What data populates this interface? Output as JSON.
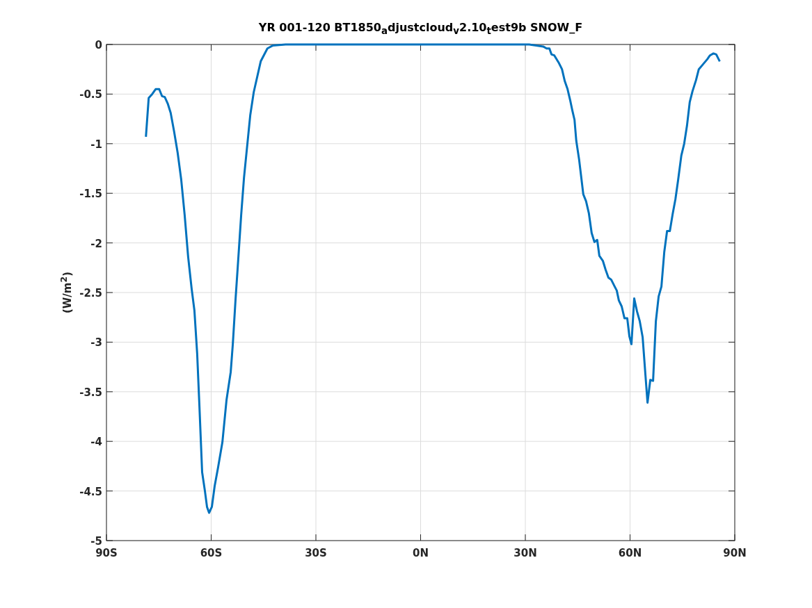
{
  "figure": {
    "chart_data": {
      "type": "line",
      "title": "YR 001-120 BT1850$_{a}$djustcloud$_{v}$2.10$_{t}$est9b SNOW_F",
      "ylabel": "(W/m$^{2}$)",
      "x": [
        -78.7,
        -77.9,
        -76.9,
        -75.9,
        -74.9,
        -74.1,
        -73.3,
        -72.4,
        -71.6,
        -70.6,
        -69.6,
        -68.6,
        -67.6,
        -66.6,
        -65.6,
        -64.8,
        -64.0,
        -63.4,
        -62.6,
        -61.8,
        -61.2,
        -60.6,
        -59.8,
        -59.0,
        -58.0,
        -56.8,
        -55.6,
        -54.4,
        -53.8,
        -53.0,
        -52.4,
        -51.4,
        -50.6,
        -49.8,
        -48.8,
        -47.8,
        -45.8,
        -43.9,
        -42.3,
        -38.7,
        31.1,
        33.1,
        35.1,
        36.1,
        36.9,
        37.5,
        38.3,
        39.5,
        40.5,
        41.3,
        42.1,
        42.9,
        43.5,
        44.1,
        44.6,
        45.4,
        46.6,
        47.4,
        48.2,
        49.0,
        49.8,
        50.6,
        51.2,
        52.2,
        53.0,
        53.8,
        54.6,
        55.6,
        56.2,
        56.8,
        57.6,
        58.4,
        59.2,
        59.8,
        60.4,
        61.2,
        62.0,
        62.8,
        63.6,
        64.4,
        65.0,
        65.8,
        66.6,
        67.4,
        68.2,
        69.0,
        69.8,
        70.6,
        71.4,
        72.2,
        73.0,
        73.8,
        74.7,
        75.5,
        76.3,
        77.1,
        77.9,
        78.9,
        79.7,
        80.9,
        82.1,
        82.9,
        83.9,
        84.7,
        85.7
      ],
      "series": [
        {
          "color": "#0072bd",
          "values": [
            -0.93,
            -0.54,
            -0.5,
            -0.45,
            -0.45,
            -0.52,
            -0.53,
            -0.6,
            -0.69,
            -0.88,
            -1.09,
            -1.36,
            -1.72,
            -2.14,
            -2.46,
            -2.68,
            -3.12,
            -3.61,
            -4.31,
            -4.5,
            -4.66,
            -4.72,
            -4.66,
            -4.45,
            -4.26,
            -4.01,
            -3.58,
            -3.3,
            -3.02,
            -2.56,
            -2.25,
            -1.72,
            -1.34,
            -1.06,
            -0.71,
            -0.48,
            -0.17,
            -0.04,
            -0.01,
            0,
            0,
            -0.01,
            -0.02,
            -0.04,
            -0.04,
            -0.1,
            -0.11,
            -0.18,
            -0.25,
            -0.37,
            -0.45,
            -0.57,
            -0.67,
            -0.76,
            -0.97,
            -1.16,
            -1.51,
            -1.58,
            -1.7,
            -1.9,
            -1.99,
            -1.97,
            -2.13,
            -2.18,
            -2.27,
            -2.35,
            -2.37,
            -2.44,
            -2.48,
            -2.58,
            -2.64,
            -2.76,
            -2.76,
            -2.94,
            -3.02,
            -2.56,
            -2.69,
            -2.79,
            -2.95,
            -3.33,
            -3.61,
            -3.38,
            -3.39,
            -2.79,
            -2.54,
            -2.44,
            -2.09,
            -1.88,
            -1.88,
            -1.71,
            -1.56,
            -1.36,
            -1.12,
            -1.0,
            -0.82,
            -0.58,
            -0.47,
            -0.36,
            -0.25,
            -0.2,
            -0.15,
            -0.11,
            -0.09,
            -0.1,
            -0.17
          ]
        }
      ],
      "grid": true,
      "xlim": [
        -90,
        90
      ],
      "ylim": [
        -5,
        0
      ],
      "xticks": [
        {
          "value": -90,
          "label": "90S"
        },
        {
          "value": -60,
          "label": "60S"
        },
        {
          "value": -30,
          "label": "30S"
        },
        {
          "value": 0,
          "label": "0N"
        },
        {
          "value": 30,
          "label": "30N"
        },
        {
          "value": 60,
          "label": "60N"
        },
        {
          "value": 90,
          "label": "90N"
        }
      ],
      "yticks": [
        0,
        -0.5,
        -1,
        -1.5,
        -2,
        -2.5,
        -3,
        -3.5,
        -4,
        -4.5,
        -5
      ]
    }
  }
}
